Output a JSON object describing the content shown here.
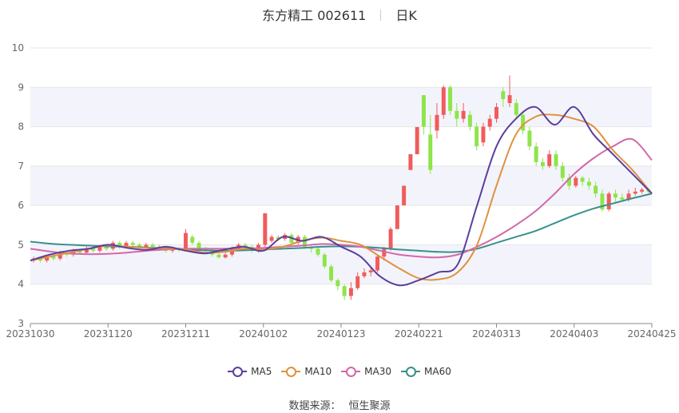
{
  "header": {
    "stock_name": "东方精工 002611",
    "period": "日K"
  },
  "source": {
    "label": "数据来源：",
    "provider": "恒生聚源"
  },
  "colors": {
    "up": "#f15b5b",
    "down": "#8de54a",
    "ma5": "#5b3f9e",
    "ma10": "#e0913f",
    "ma30": "#d268a8",
    "ma60": "#3a8f8c",
    "grid": "#e6e6e6",
    "band": "#f3f4fb"
  },
  "chart_data": {
    "type": "candlestick",
    "ylim": [
      3,
      10
    ],
    "y_ticks": [
      3,
      4,
      5,
      6,
      7,
      8,
      9,
      10
    ],
    "x_tick_labels": [
      "20231030",
      "20231120",
      "20231211",
      "20240102",
      "20240123",
      "20240221",
      "20240313",
      "20240403",
      "20240425"
    ],
    "grid": true,
    "legend_position": "bottom-center",
    "series": [
      {
        "name": "MA5",
        "color": "#5b3f9e",
        "x": [
          0,
          5,
          10,
          15,
          20,
          25,
          30,
          35,
          40,
          45,
          50,
          55,
          60,
          65,
          70,
          75,
          80,
          85,
          90,
          95,
          100,
          105,
          110,
          115,
          120,
          125,
          130,
          135,
          140,
          145,
          150,
          155,
          160
        ],
        "values": [
          4.6,
          4.75,
          4.85,
          4.9,
          5.0,
          4.92,
          4.87,
          4.95,
          4.85,
          4.78,
          4.88,
          4.95,
          4.85,
          5.2,
          5.1,
          5.2,
          4.95,
          4.7,
          4.2,
          3.97,
          4.1,
          4.3,
          4.5,
          6.0,
          7.5,
          8.2,
          8.5,
          8.05,
          8.5,
          7.8,
          7.3,
          6.8,
          6.3
        ]
      },
      {
        "name": "MA10",
        "color": "#e0913f",
        "x": [
          0,
          5,
          10,
          15,
          20,
          25,
          30,
          35,
          40,
          45,
          50,
          55,
          60,
          65,
          70,
          75,
          80,
          85,
          90,
          95,
          100,
          105,
          110,
          115,
          120,
          125,
          130,
          135,
          140,
          145,
          150,
          155,
          160
        ],
        "values": [
          4.6,
          4.7,
          4.8,
          4.9,
          4.98,
          4.95,
          4.92,
          4.9,
          4.88,
          4.8,
          4.82,
          4.9,
          4.88,
          4.95,
          5.1,
          5.18,
          5.1,
          5.0,
          4.7,
          4.4,
          4.15,
          4.12,
          4.3,
          5.0,
          6.5,
          7.8,
          8.25,
          8.3,
          8.2,
          8.0,
          7.4,
          6.9,
          6.3
        ]
      },
      {
        "name": "MA30",
        "color": "#d268a8",
        "x": [
          0,
          5,
          10,
          15,
          20,
          25,
          30,
          35,
          40,
          45,
          50,
          55,
          60,
          65,
          70,
          75,
          80,
          85,
          90,
          95,
          100,
          105,
          110,
          115,
          120,
          125,
          130,
          135,
          140,
          145,
          150,
          155,
          160
        ],
        "values": [
          4.9,
          4.83,
          4.78,
          4.76,
          4.77,
          4.8,
          4.85,
          4.88,
          4.9,
          4.9,
          4.9,
          4.9,
          4.92,
          4.95,
          4.98,
          5.02,
          5.0,
          4.95,
          4.85,
          4.75,
          4.7,
          4.68,
          4.75,
          4.95,
          5.2,
          5.5,
          5.85,
          6.3,
          6.8,
          7.2,
          7.5,
          7.68,
          7.15
        ]
      },
      {
        "name": "MA60",
        "color": "#3a8f8c",
        "x": [
          0,
          5,
          10,
          15,
          20,
          25,
          30,
          35,
          40,
          45,
          50,
          55,
          60,
          65,
          70,
          75,
          80,
          85,
          90,
          95,
          100,
          105,
          110,
          115,
          120,
          125,
          130,
          135,
          140,
          145,
          150,
          155,
          160
        ],
        "values": [
          5.08,
          5.03,
          5.0,
          4.98,
          4.96,
          4.95,
          4.93,
          4.91,
          4.88,
          4.86,
          4.85,
          4.86,
          4.88,
          4.9,
          4.92,
          4.95,
          4.96,
          4.95,
          4.92,
          4.88,
          4.85,
          4.82,
          4.82,
          4.9,
          5.05,
          5.2,
          5.35,
          5.55,
          5.75,
          5.92,
          6.05,
          6.18,
          6.3
        ]
      }
    ],
    "candles": [
      [
        4.6,
        4.65,
        4.7,
        4.55
      ],
      [
        4.65,
        4.6,
        4.7,
        4.55
      ],
      [
        4.6,
        4.7,
        4.75,
        4.55
      ],
      [
        4.7,
        4.65,
        4.75,
        4.6
      ],
      [
        4.65,
        4.8,
        4.85,
        4.6
      ],
      [
        4.8,
        4.75,
        4.85,
        4.7
      ],
      [
        4.75,
        4.85,
        4.9,
        4.7
      ],
      [
        4.85,
        4.8,
        4.9,
        4.75
      ],
      [
        4.8,
        4.9,
        4.95,
        4.78
      ],
      [
        4.9,
        4.85,
        4.95,
        4.8
      ],
      [
        4.85,
        4.95,
        5.0,
        4.8
      ],
      [
        4.95,
        4.9,
        5.0,
        4.85
      ],
      [
        4.9,
        5.05,
        5.1,
        4.85
      ],
      [
        5.05,
        4.95,
        5.1,
        4.9
      ],
      [
        4.95,
        5.05,
        5.1,
        4.92
      ],
      [
        5.05,
        5.0,
        5.1,
        4.95
      ],
      [
        5.0,
        4.95,
        5.05,
        4.9
      ],
      [
        4.95,
        5.0,
        5.05,
        4.9
      ],
      [
        5.0,
        4.95,
        5.05,
        4.88
      ],
      [
        4.95,
        4.9,
        5.0,
        4.85
      ],
      [
        4.9,
        4.85,
        4.95,
        4.8
      ],
      [
        4.85,
        4.9,
        4.95,
        4.8
      ],
      [
        4.9,
        4.88,
        4.95,
        4.82
      ],
      [
        4.88,
        5.3,
        5.4,
        4.85
      ],
      [
        5.2,
        5.05,
        5.25,
        5.0
      ],
      [
        5.05,
        4.9,
        5.1,
        4.85
      ],
      [
        4.9,
        4.85,
        4.95,
        4.8
      ],
      [
        4.85,
        4.75,
        4.9,
        4.7
      ],
      [
        4.75,
        4.68,
        4.8,
        4.65
      ],
      [
        4.68,
        4.75,
        4.8,
        4.65
      ],
      [
        4.75,
        4.9,
        4.95,
        4.7
      ],
      [
        4.9,
        5.0,
        5.05,
        4.85
      ],
      [
        5.0,
        4.95,
        5.05,
        4.9
      ],
      [
        4.95,
        4.85,
        5.0,
        4.8
      ],
      [
        4.85,
        5.0,
        5.05,
        4.8
      ],
      [
        5.0,
        5.8,
        5.8,
        4.95
      ],
      [
        5.1,
        5.2,
        5.25,
        5.05
      ],
      [
        5.2,
        5.15,
        5.25,
        5.1
      ],
      [
        5.15,
        5.25,
        5.3,
        5.1
      ],
      [
        5.25,
        5.05,
        5.3,
        5.0
      ],
      [
        5.05,
        5.2,
        5.25,
        5.0
      ],
      [
        5.2,
        4.95,
        5.25,
        4.9
      ],
      [
        4.95,
        4.9,
        5.0,
        4.8
      ],
      [
        4.9,
        4.75,
        4.95,
        4.7
      ],
      [
        4.75,
        4.45,
        4.8,
        4.4
      ],
      [
        4.45,
        4.1,
        4.5,
        4.05
      ],
      [
        4.1,
        3.95,
        4.15,
        3.85
      ],
      [
        3.95,
        3.7,
        4.0,
        3.6
      ],
      [
        3.7,
        3.9,
        4.05,
        3.6
      ],
      [
        3.9,
        4.2,
        4.3,
        3.85
      ],
      [
        4.2,
        4.3,
        4.4,
        4.15
      ],
      [
        4.3,
        4.35,
        4.45,
        4.2
      ],
      [
        4.35,
        4.7,
        4.75,
        4.3
      ],
      [
        4.7,
        4.9,
        4.95,
        4.6
      ],
      [
        4.9,
        5.4,
        5.45,
        4.85
      ],
      [
        5.4,
        6.0,
        6.0,
        5.4
      ],
      [
        6.0,
        6.5,
        6.5,
        6.0
      ],
      [
        6.9,
        7.3,
        7.3,
        6.9
      ],
      [
        7.3,
        7.99,
        7.99,
        7.3
      ],
      [
        8.8,
        8.0,
        8.8,
        7.8
      ],
      [
        7.8,
        6.9,
        8.3,
        6.8
      ],
      [
        7.9,
        8.3,
        8.6,
        7.7
      ],
      [
        8.3,
        9.0,
        9.05,
        8.2
      ],
      [
        9.0,
        8.4,
        9.05,
        8.3
      ],
      [
        8.4,
        8.2,
        8.6,
        8.0
      ],
      [
        8.2,
        8.4,
        8.6,
        8.1
      ],
      [
        8.3,
        8.0,
        8.4,
        7.9
      ],
      [
        8.0,
        7.5,
        8.1,
        7.4
      ],
      [
        7.6,
        8.0,
        8.1,
        7.5
      ],
      [
        8.0,
        8.2,
        8.3,
        7.9
      ],
      [
        8.2,
        8.5,
        8.6,
        8.1
      ],
      [
        8.9,
        8.7,
        9.0,
        8.5
      ],
      [
        8.6,
        8.8,
        9.3,
        8.5
      ],
      [
        8.6,
        8.3,
        8.7,
        8.2
      ],
      [
        8.3,
        7.9,
        8.4,
        7.8
      ],
      [
        7.9,
        7.5,
        8.0,
        7.4
      ],
      [
        7.5,
        7.1,
        7.6,
        7.0
      ],
      [
        7.1,
        7.0,
        7.2,
        6.9
      ],
      [
        7.0,
        7.3,
        7.4,
        6.95
      ],
      [
        7.3,
        7.0,
        7.4,
        6.9
      ],
      [
        7.0,
        6.7,
        7.1,
        6.6
      ],
      [
        6.7,
        6.5,
        6.8,
        6.4
      ],
      [
        6.5,
        6.7,
        6.75,
        6.45
      ],
      [
        6.7,
        6.6,
        6.75,
        6.5
      ],
      [
        6.6,
        6.5,
        6.7,
        6.4
      ],
      [
        6.5,
        6.3,
        6.6,
        6.2
      ],
      [
        6.3,
        5.9,
        6.4,
        5.85
      ],
      [
        5.9,
        6.3,
        6.35,
        5.85
      ],
      [
        6.3,
        6.2,
        6.4,
        6.1
      ],
      [
        6.2,
        6.15,
        6.3,
        6.1
      ],
      [
        6.15,
        6.3,
        6.4,
        6.1
      ],
      [
        6.3,
        6.35,
        6.45,
        6.25
      ],
      [
        6.35,
        6.4,
        6.45,
        6.3
      ],
      [
        6.4,
        6.35,
        6.45,
        6.3
      ]
    ]
  }
}
